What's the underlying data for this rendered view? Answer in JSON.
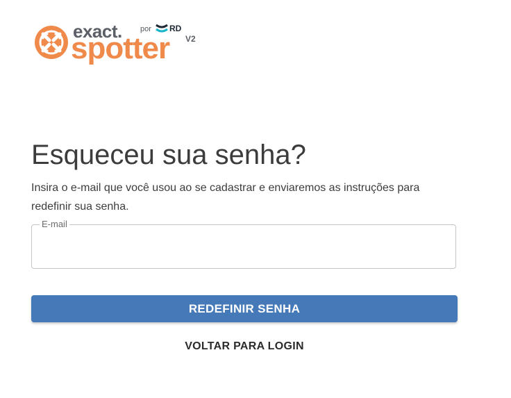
{
  "logo": {
    "word_exact": "exact.",
    "word_spotter": "spotter",
    "word_por": "por",
    "word_rd": "RD",
    "word_v2": "V2",
    "emblem_icon": "exact-spotter-emblem-icon",
    "rd_icon": "rd-station-mark-icon"
  },
  "heading": {
    "title": "Esqueceu sua senha?",
    "description": "Insira o e-mail que você usou ao se cadastrar e enviaremos as instruções para redefinir sua senha."
  },
  "form": {
    "email_label": "E-mail",
    "email_value": "",
    "submit_label": "REDEFINIR SENHA",
    "back_label": "VOLTAR PARA LOGIN"
  },
  "colors": {
    "brand_orange": "#f08a4b",
    "button_blue": "#4579b8",
    "text_dark": "#3c3c3c"
  }
}
